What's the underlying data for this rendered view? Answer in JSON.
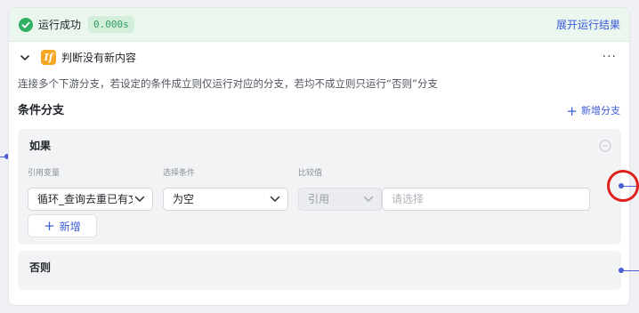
{
  "status": {
    "label": "运行成功",
    "duration": "0.000s",
    "expand_link": "展开运行结果",
    "success_color": "#2fb063",
    "icon": "check-circle-icon"
  },
  "node": {
    "badge": "If",
    "title": "判断没有新内容",
    "more": "···",
    "description": "连接多个下游分支，若设定的条件成立则仅运行对应的分支，若均不成立则只运行“否则”分支",
    "badge_color": "#f5a623"
  },
  "branches": {
    "section_title": "条件分支",
    "add_branch_label": "新增分支"
  },
  "if_branch": {
    "title": "如果",
    "columns": {
      "variable": "引用变量",
      "condition": "选择条件",
      "compare": "比较值"
    },
    "row": {
      "variable_value": "循环_查询去重已有文",
      "condition_value": "为空",
      "compare_type": "引用",
      "compare_placeholder": "请选择"
    },
    "add_label": "新增"
  },
  "else_branch": {
    "title": "否则"
  },
  "accent_color": "#3b5bdb",
  "annotation_color": "#e0201c"
}
